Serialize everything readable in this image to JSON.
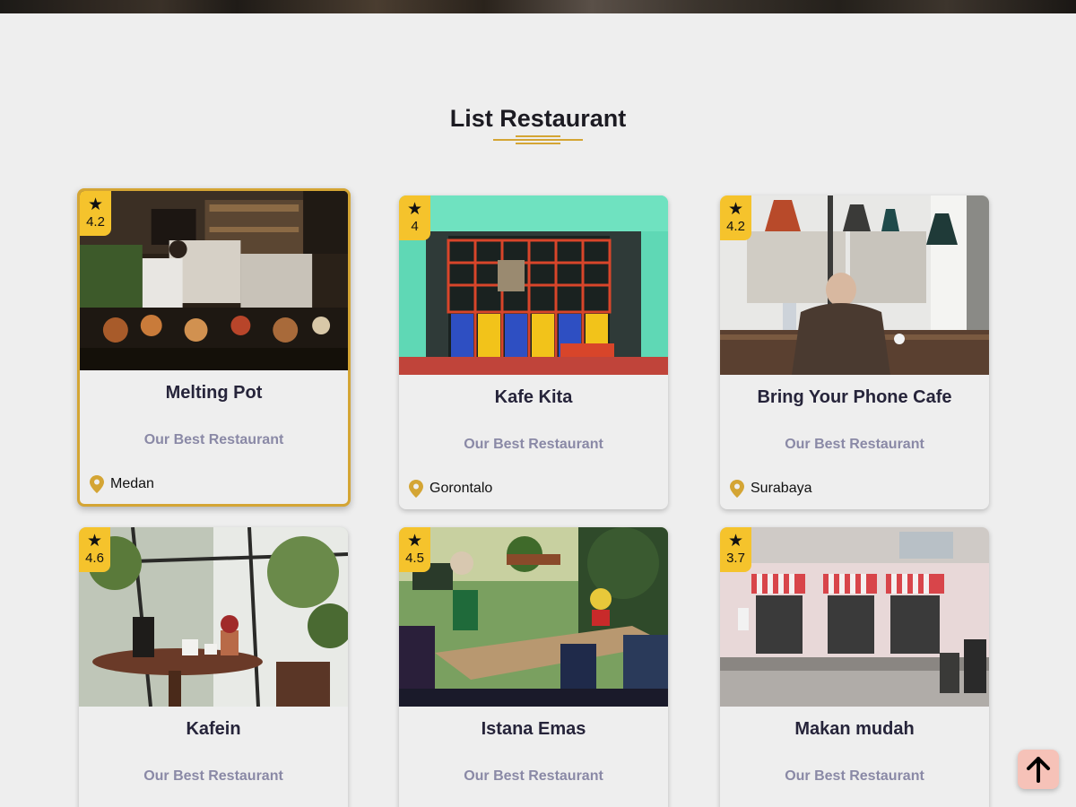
{
  "section": {
    "title": "List Restaurant"
  },
  "restaurants": [
    {
      "name": "Melting Pot",
      "subtitle": "Our Best Restaurant",
      "city": "Medan",
      "rating": "4.2",
      "image": "open kitchen with chef and food display"
    },
    {
      "name": "Kafe Kita",
      "subtitle": "Our Best Restaurant",
      "city": "Gorontalo",
      "rating": "4",
      "image": "teal storefront with colorful window frames"
    },
    {
      "name": "Bring Your Phone Cafe",
      "subtitle": "Our Best Restaurant",
      "city": "Surabaya",
      "rating": "4.2",
      "image": "cafe interior with hanging lamps and seated man"
    },
    {
      "name": "Kafein",
      "subtitle": "Our Best Restaurant",
      "city": "",
      "rating": "4.6",
      "image": "greenhouse cafe table with coffee press"
    },
    {
      "name": "Istana Emas",
      "subtitle": "Our Best Restaurant",
      "city": "",
      "rating": "4.5",
      "image": "outdoor cafe tables with plants"
    },
    {
      "name": "Makan mudah",
      "subtitle": "Our Best Restaurant",
      "city": "",
      "rating": "3.7",
      "image": "shop front with striped awnings"
    }
  ],
  "icons": {
    "rating": "star-icon",
    "location": "location-pin-icon",
    "scroll_top": "arrow-up-icon"
  },
  "colors": {
    "accent": "#d4a534",
    "rating_badge": "#f5c32c",
    "scroll_button": "#f6c2b8",
    "title": "#26243a",
    "subtitle": "#8a89a6"
  }
}
